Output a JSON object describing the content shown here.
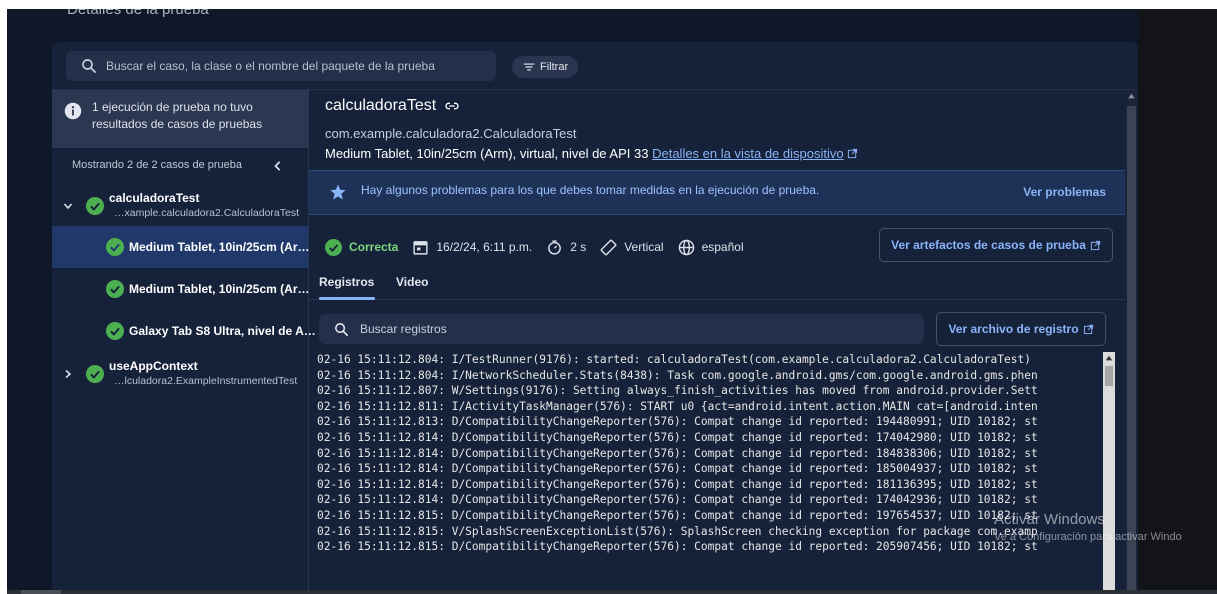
{
  "page_title": "Detalles de la prueba",
  "search": {
    "placeholder": "Buscar el caso, la clase o el nombre del paquete de la prueba"
  },
  "filter": {
    "label": "Filtrar"
  },
  "sidebar": {
    "notice": "1 ejecución de prueba no tuvo resultados de casos de pruebas",
    "showing": "Mostrando 2 de 2 casos de prueba",
    "tests": [
      {
        "name": "calculadoraTest",
        "package": "…xample.calculadora2.CalculadoraTest",
        "devices": [
          "Medium Tablet, 10in/25cm (Ar…",
          "Medium Tablet, 10in/25cm (Ar…",
          "Galaxy Tab S8 Ultra, nivel de A…"
        ]
      },
      {
        "name": "useAppContext",
        "package": "…lculadora2.ExampleInstrumentedTest"
      }
    ]
  },
  "main": {
    "title": "calculadoraTest",
    "class": "com.example.calculadora2.CalculadoraTest",
    "device": "Medium Tablet, 10in/25cm (Arm), virtual, nivel de API 33",
    "device_link": "Detalles en la vista de dispositivo",
    "banner": {
      "text": "Hay algunos problemas para los que debes tomar medidas en la ejecución de prueba.",
      "button": "Ver problemas"
    },
    "status": {
      "result": "Correcta",
      "date": "16/2/24, 6:11 p.m.",
      "duration": "2 s",
      "orientation": "Vertical",
      "locale": "español"
    },
    "artifacts_button": "Ver artefactos de casos de prueba",
    "tabs": [
      "Registros",
      "Video"
    ],
    "log_search": "Buscar registros",
    "log_file_button": "Ver archivo de registro",
    "log_lines": [
      "02-16 15:11:12.804: I/TestRunner(9176): started: calculadoraTest(com.example.calculadora2.CalculadoraTest)",
      "02-16 15:11:12.804: I/NetworkScheduler.Stats(8438): Task com.google.android.gms/com.google.android.gms.phen",
      "02-16 15:11:12.807: W/Settings(9176): Setting always_finish_activities has moved from android.provider.Sett",
      "02-16 15:11:12.811: I/ActivityTaskManager(576): START u0 {act=android.intent.action.MAIN cat=[android.inten",
      "02-16 15:11:12.813: D/CompatibilityChangeReporter(576): Compat change id reported: 194480991; UID 10182; st",
      "02-16 15:11:12.814: D/CompatibilityChangeReporter(576): Compat change id reported: 174042980; UID 10182; st",
      "02-16 15:11:12.814: D/CompatibilityChangeReporter(576): Compat change id reported: 184838306; UID 10182; st",
      "02-16 15:11:12.814: D/CompatibilityChangeReporter(576): Compat change id reported: 185004937; UID 10182; st",
      "02-16 15:11:12.814: D/CompatibilityChangeReporter(576): Compat change id reported: 181136395; UID 10182; st",
      "02-16 15:11:12.814: D/CompatibilityChangeReporter(576): Compat change id reported: 174042936; UID 10182; st",
      "02-16 15:11:12.815: D/CompatibilityChangeReporter(576): Compat change id reported: 197654537; UID 10182; st",
      "02-16 15:11:12.815: V/SplashScreenExceptionList(576): SplashScreen checking exception for package com.examp",
      "02-16 15:11:12.815: D/CompatibilityChangeReporter(576): Compat change id reported: 205907456; UID 10182; st"
    ]
  },
  "watermark": {
    "title": "Activar Windows",
    "subtitle": "Ve a Configuración para activar Windo"
  },
  "colors": {
    "background": "#0f1829",
    "panel": "#16223a",
    "selected": "#21386a",
    "accent": "#8ab4f8",
    "success": "#4caf50"
  }
}
